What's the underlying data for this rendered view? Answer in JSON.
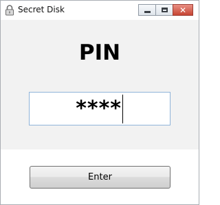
{
  "window": {
    "title": "Secret Disk",
    "title_icon": "lock-icon",
    "controls": {
      "minimize_icon": "minimize-icon",
      "maximize_icon": "maximize-icon",
      "close_icon": "close-icon",
      "close_glyph": "✕"
    }
  },
  "main": {
    "heading": "PIN",
    "pin_field": {
      "value": "****"
    },
    "enter_button": {
      "label": "Enter"
    }
  },
  "colors": {
    "close_button": "#c64533",
    "input_border": "#8fb3d9",
    "content_bg": "#f2f2f2"
  }
}
